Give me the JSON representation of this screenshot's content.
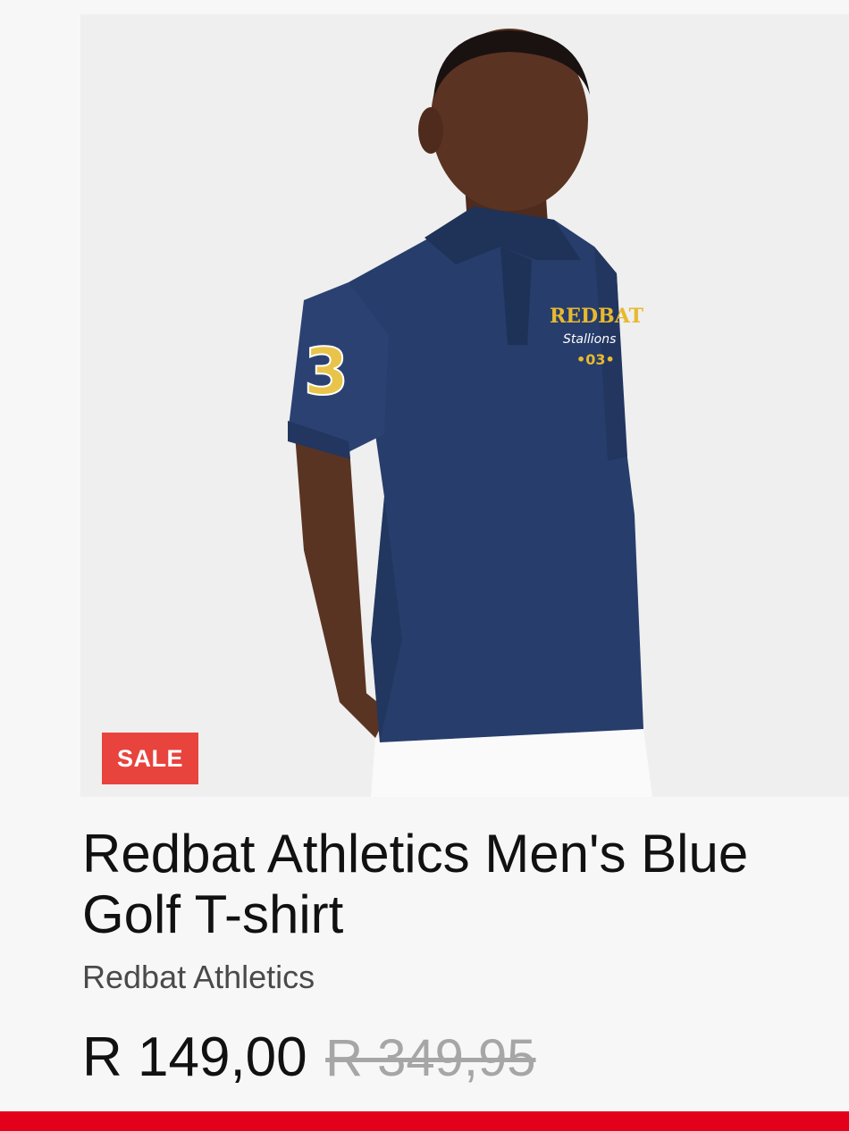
{
  "product": {
    "badge": "SALE",
    "title": "Redbat Athletics Men's Blue Golf T-shirt",
    "brand": "Redbat Athletics",
    "price_current": "R 149,00",
    "price_original": "R 349,95",
    "image_label": "Man wearing navy polo shirt"
  },
  "colors": {
    "badge": "#e8433d",
    "accent_bar": "#e3001b",
    "shirt": "#273d6b",
    "text_primary": "#111111",
    "text_secondary": "#4a4a4a",
    "strike_price": "#a6a6a6"
  },
  "icons": {
    "product_image": "photo-polo-shirt"
  }
}
